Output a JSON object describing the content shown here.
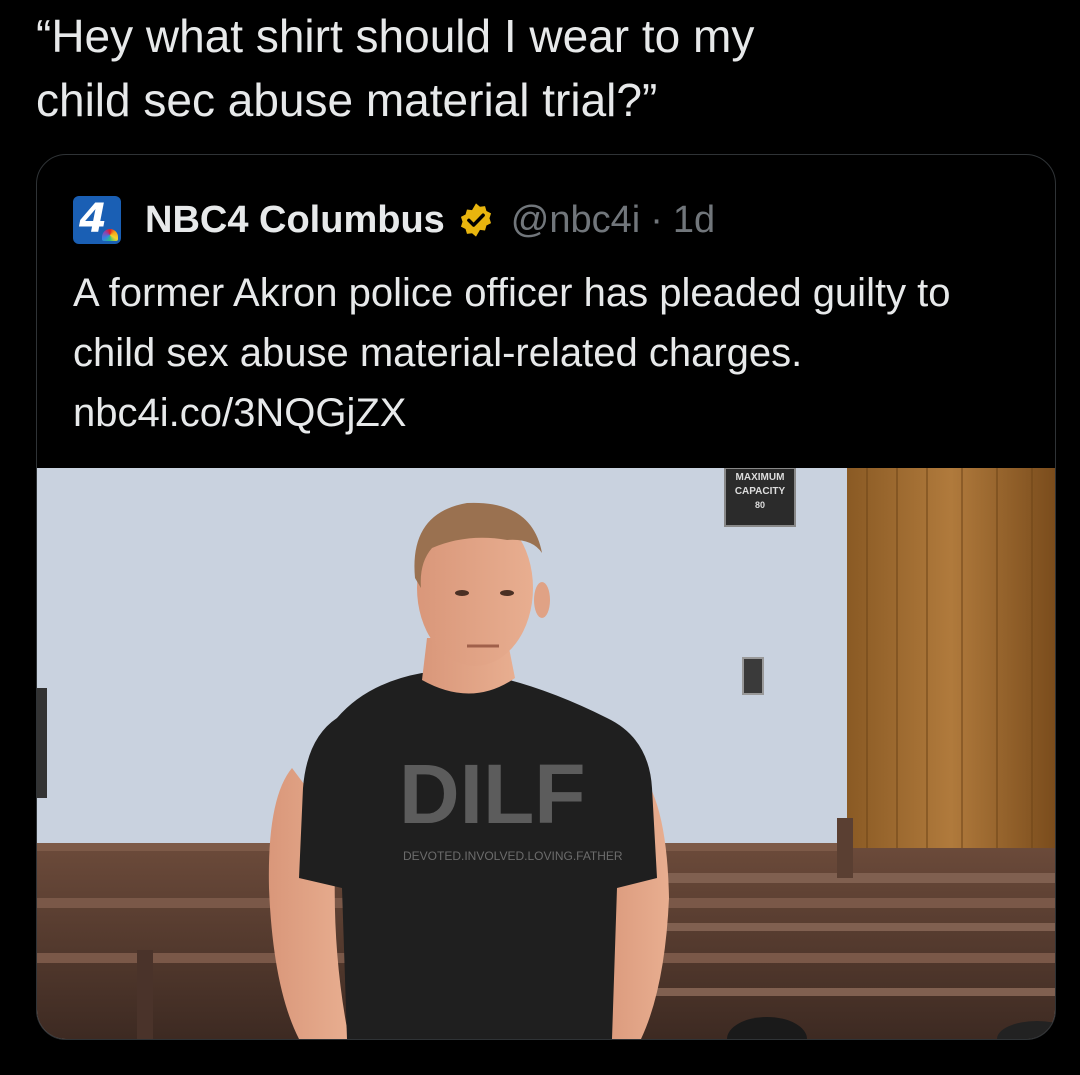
{
  "tweet": {
    "text": "“Hey what shirt should I wear to my\nchild sec abuse material trial?”"
  },
  "quote": {
    "display_name": "NBC4 Columbus",
    "handle": "@nbc4i",
    "separator": "·",
    "time": "1d",
    "avatar_label": "4",
    "body": "A former Akron police officer has pleaded guilty to child sex abuse material-related charges. nbc4i.co/3NQGjZX",
    "verified_color": "#e8b50e",
    "photo": {
      "sign_lines": [
        "MAXIMUM",
        "CAPACITY",
        "80"
      ],
      "shirt_big": "DILF",
      "shirt_small": "DEVOTED.INVOLVED.LOVING.FATHER"
    }
  },
  "colors": {
    "background": "#000000",
    "text": "#e7e9ea",
    "muted": "#71767b",
    "border": "#2f3336",
    "brand": "#1a5fb4"
  }
}
